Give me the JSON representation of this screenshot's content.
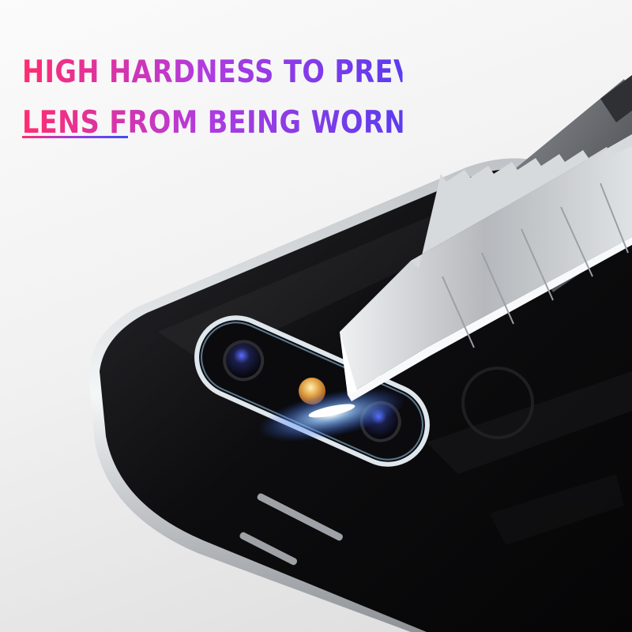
{
  "headline": {
    "line1": "HIGH HARDNESS TO PREVENT THE",
    "line2": "LENS FROM BEING WORN"
  },
  "colors": {
    "gradient_start": "#ff2d6f",
    "gradient_mid": "#b13be0",
    "gradient_end": "#5b3bf0",
    "phone_body": "#0f0f11",
    "lens_ring": "#d9e6ee",
    "blade": "#c9cbce"
  },
  "icons": {
    "product": "phone-back-icon",
    "tool": "utility-knife-icon"
  }
}
